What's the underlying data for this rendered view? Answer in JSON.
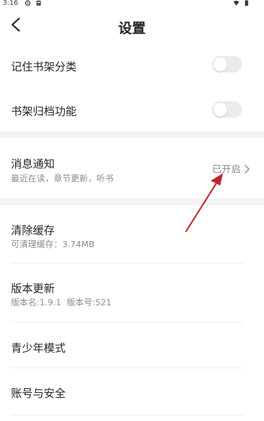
{
  "status_bar": {
    "time": "3:16"
  },
  "header": {
    "title": "设置"
  },
  "settings": {
    "remember_shelf": {
      "label": "记住书架分类",
      "enabled": false
    },
    "shelf_archive": {
      "label": "书架归档功能",
      "enabled": false
    },
    "notifications": {
      "label": "消息通知",
      "subtitle": "最近在读，章节更新，听书",
      "status": "已开启"
    },
    "clear_cache": {
      "label": "清除缓存",
      "subtitle": "可清理缓存：3.74MB"
    },
    "version_update": {
      "label": "版本更新",
      "subtitle": "版本名:1.9.1  版本号:521"
    },
    "teen_mode": {
      "label": "青少年模式"
    },
    "account_security": {
      "label": "账号与安全"
    }
  },
  "colors": {
    "annotation_arrow": "#c0272d",
    "gap": "#f3f3f3",
    "toggle_off": "#ebebeb"
  }
}
